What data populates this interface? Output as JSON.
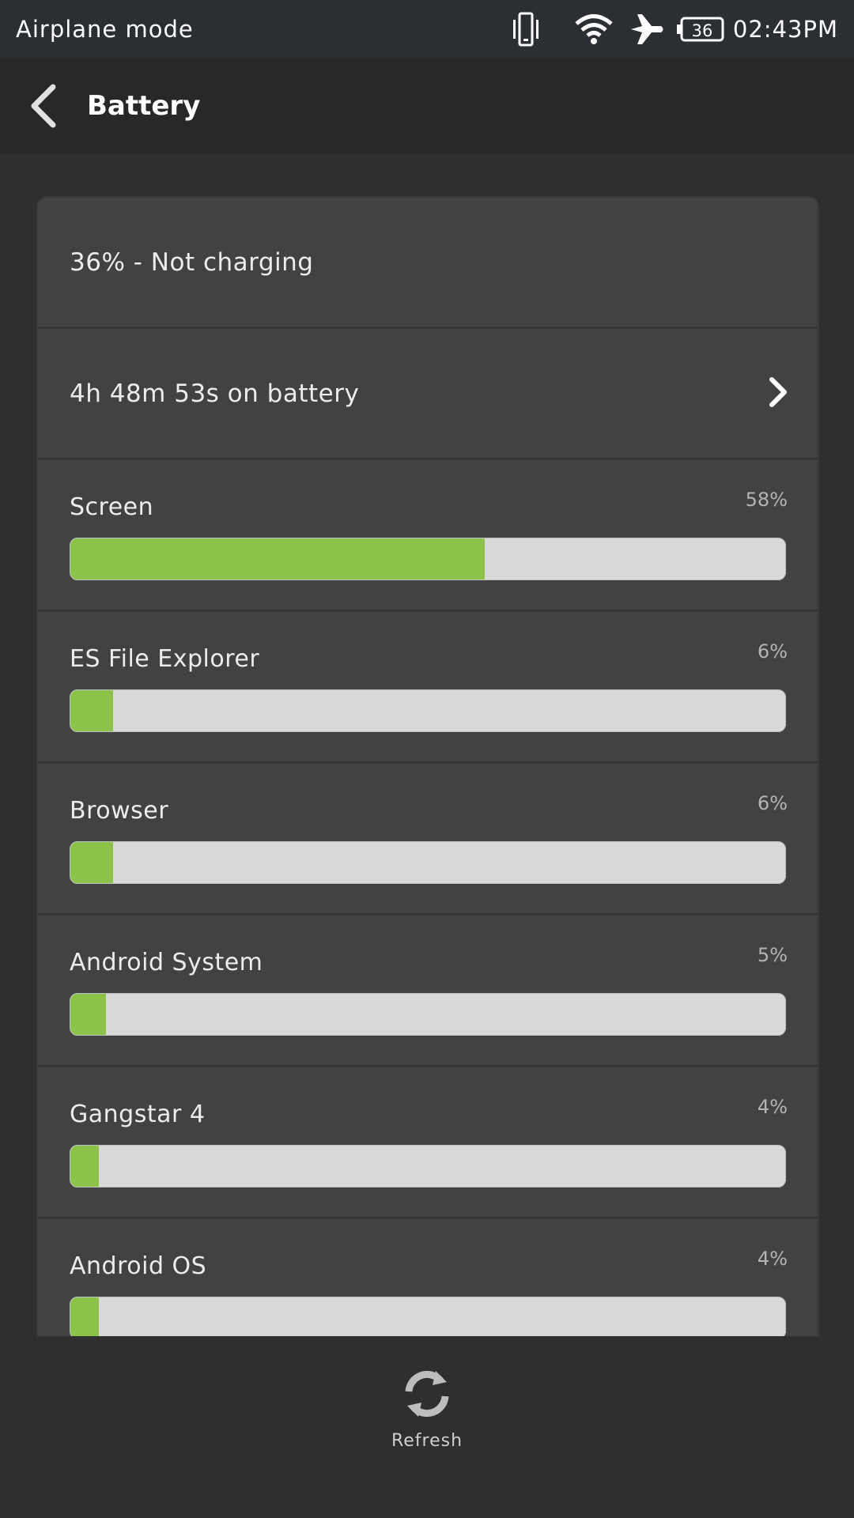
{
  "status_bar": {
    "left_text": "Airplane mode",
    "battery_level": "36",
    "time": "02:43PM",
    "icons": [
      "vibrate-icon",
      "wifi-icon",
      "airplane-icon",
      "battery-icon"
    ]
  },
  "header": {
    "title": "Battery",
    "back_icon": "chevron-left-icon"
  },
  "summary": {
    "status_text": "36% - Not charging",
    "duration_text": "4h 48m 53s on battery"
  },
  "usage": [
    {
      "label": "Screen",
      "percent_text": "58%",
      "fraction": 0.58
    },
    {
      "label": "ES File Explorer",
      "percent_text": "6%",
      "fraction": 0.06
    },
    {
      "label": "Browser",
      "percent_text": "6%",
      "fraction": 0.06
    },
    {
      "label": "Android System",
      "percent_text": "5%",
      "fraction": 0.05
    },
    {
      "label": "Gangstar 4",
      "percent_text": "4%",
      "fraction": 0.04
    },
    {
      "label": "Android OS",
      "percent_text": "4%",
      "fraction": 0.04
    }
  ],
  "footer": {
    "refresh_label": "Refresh"
  },
  "colors": {
    "bar_fill": "#8bc34a",
    "bar_track": "#d9d9d9",
    "card_bg": "#424242",
    "page_bg": "#2f2f2f"
  }
}
